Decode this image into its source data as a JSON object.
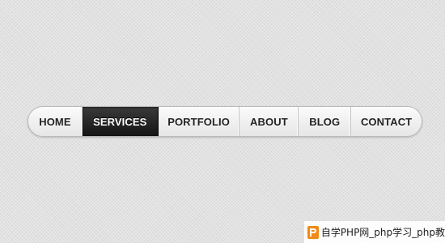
{
  "nav": {
    "items": [
      {
        "label": "HOME",
        "active": false
      },
      {
        "label": "SERVICES",
        "active": true
      },
      {
        "label": "PORTFOLIO",
        "active": false
      },
      {
        "label": "ABOUT",
        "active": false
      },
      {
        "label": "BLOG",
        "active": false
      },
      {
        "label": "CONTACT",
        "active": false
      }
    ]
  },
  "watermark": {
    "text": "自学PHP网_php学习_php教",
    "logo_icon": "php-site-logo-icon"
  },
  "colors": {
    "background": "#e1e1e1",
    "nav_bar": "#f1f1f1",
    "active_item": "#1e1e1e",
    "logo_accent": "#f08a18"
  }
}
